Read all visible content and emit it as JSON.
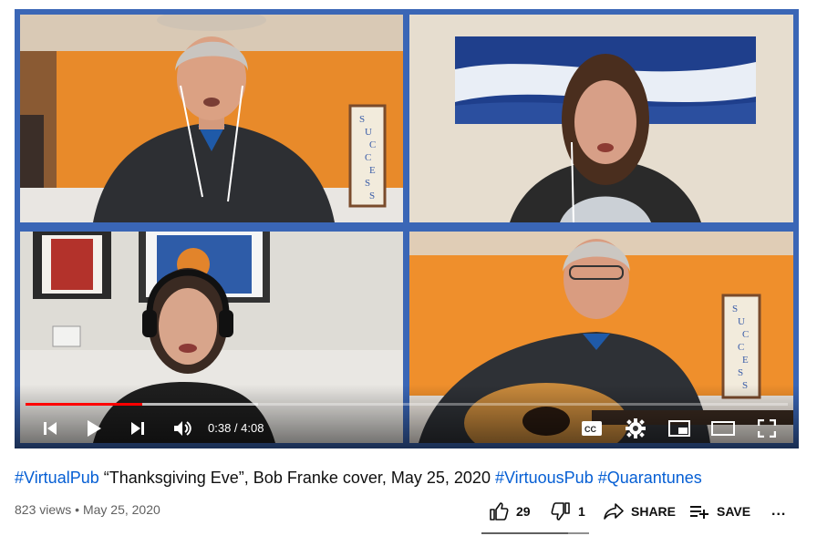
{
  "player": {
    "current_time": "0:38",
    "separator": " / ",
    "duration": "4:08",
    "progress_played": 0.153,
    "progress_loaded": 0.305,
    "accent_color": "#ff0000",
    "frame_color": "#3a66b6"
  },
  "scene": {
    "poster_letters": [
      "S",
      "U",
      "C",
      "C",
      "E",
      "S",
      "S"
    ]
  },
  "video": {
    "title_parts": [
      {
        "text": "#VirtualPub",
        "hashtag": true
      },
      {
        "text": " “Thanksgiving Eve”, Bob Franke cover, May 25, 2020 ",
        "hashtag": false
      },
      {
        "text": "#VirtuousPub",
        "hashtag": true
      },
      {
        "text": " ",
        "hashtag": false
      },
      {
        "text": "#Quarantunes",
        "hashtag": true
      }
    ],
    "views": "823 views",
    "dot": " • ",
    "date": "May 25, 2020",
    "likes": "29",
    "dislikes": "1",
    "share_label": "SHARE",
    "save_label": "SAVE",
    "more_label": "..."
  },
  "icons": {
    "prev": "skip-previous-icon",
    "play": "play-icon",
    "next": "skip-next-icon",
    "volume": "volume-icon",
    "cc": "closed-captions-icon",
    "settings": "gear-icon",
    "miniplayer": "miniplayer-icon",
    "theater": "theater-mode-icon",
    "fullscreen": "fullscreen-icon",
    "like": "thumbs-up-icon",
    "dislike": "thumbs-down-icon",
    "share": "share-icon",
    "save": "playlist-add-icon"
  }
}
